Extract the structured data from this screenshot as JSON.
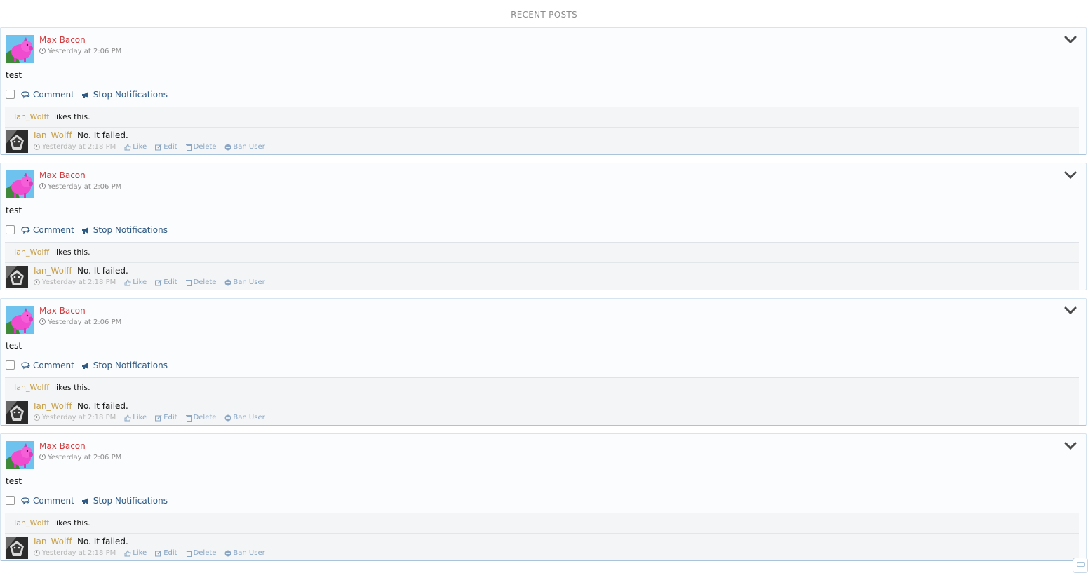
{
  "header": {
    "title": "RECENT POSTS"
  },
  "colors": {
    "author_name": "#d2393c",
    "commenter_name": "#c7a04b",
    "action_link": "#2f5a84",
    "meta_link": "#8aa6c4",
    "post_border": "#a9c3da"
  },
  "icons": {
    "chevron": "chevron-down-icon",
    "clock": "clock-icon",
    "comment": "comment-icon",
    "stop_notifications": "megaphone-icon",
    "like": "thumbs-up-icon",
    "edit": "edit-icon",
    "delete": "trash-icon",
    "ban": "ban-icon"
  },
  "posts": [
    {
      "author": "Max Bacon",
      "time": "Yesterday at 2:06 PM",
      "body": "test",
      "actions": {
        "comment": "Comment",
        "stop_notifications": "Stop Notifications"
      },
      "likes": {
        "user": "Ian_Wolff",
        "text": "likes this."
      },
      "comment": {
        "author": "Ian_Wolff",
        "text": "No. It failed.",
        "time": "Yesterday at 2:18 PM",
        "like": "Like",
        "edit": "Edit",
        "delete": "Delete",
        "ban": "Ban User"
      }
    },
    {
      "author": "Max Bacon",
      "time": "Yesterday at 2:06 PM",
      "body": "test",
      "actions": {
        "comment": "Comment",
        "stop_notifications": "Stop Notifications"
      },
      "likes": {
        "user": "Ian_Wolff",
        "text": "likes this."
      },
      "comment": {
        "author": "Ian_Wolff",
        "text": "No. It failed.",
        "time": "Yesterday at 2:18 PM",
        "like": "Like",
        "edit": "Edit",
        "delete": "Delete",
        "ban": "Ban User"
      }
    },
    {
      "author": "Max Bacon",
      "time": "Yesterday at 2:06 PM",
      "body": "test",
      "actions": {
        "comment": "Comment",
        "stop_notifications": "Stop Notifications"
      },
      "likes": {
        "user": "Ian_Wolff",
        "text": "likes this."
      },
      "comment": {
        "author": "Ian_Wolff",
        "text": "No. It failed.",
        "time": "Yesterday at 2:18 PM",
        "like": "Like",
        "edit": "Edit",
        "delete": "Delete",
        "ban": "Ban User"
      }
    },
    {
      "author": "Max Bacon",
      "time": "Yesterday at 2:06 PM",
      "body": "test",
      "actions": {
        "comment": "Comment",
        "stop_notifications": "Stop Notifications"
      },
      "likes": {
        "user": "Ian_Wolff",
        "text": "likes this."
      },
      "comment": {
        "author": "Ian_Wolff",
        "text": "No. It failed.",
        "time": "Yesterday at 2:18 PM",
        "like": "Like",
        "edit": "Edit",
        "delete": "Delete",
        "ban": "Ban User"
      }
    }
  ]
}
